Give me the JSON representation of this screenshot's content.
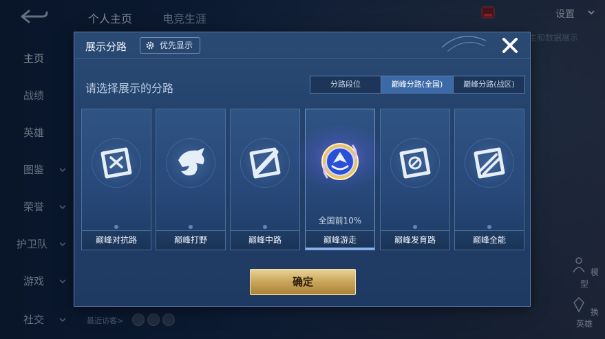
{
  "topbar": {
    "tabs": [
      "个人主页",
      "电竞生涯"
    ],
    "settings_label": "设置",
    "behind_text": "主和数据展示"
  },
  "leftnav": {
    "items": [
      "主页",
      "战绩",
      "英雄",
      "图鉴",
      "荣誉",
      "护卫队",
      "游戏",
      "社交"
    ]
  },
  "side_buttons": [
    "模型",
    "换英雄"
  ],
  "bottom": {
    "recent_label": "最近访客>"
  },
  "modal": {
    "title": "展示分路",
    "priority_label": "优先显示",
    "subtitle": "请选择展示的分路",
    "segments": [
      "分路段位",
      "巅峰分路(全国)",
      "巅峰分路(战区)"
    ],
    "selected_segment": "巅峰分路(全国)",
    "cards": [
      {
        "name": "巅峰对抗路",
        "icon": "clash-lane-icon",
        "rank": ""
      },
      {
        "name": "巅峰打野",
        "icon": "jungle-icon",
        "rank": ""
      },
      {
        "name": "巅峰中路",
        "icon": "mid-lane-icon",
        "rank": ""
      },
      {
        "name": "巅峰游走",
        "icon": "roam-icon",
        "rank": "全国前10%"
      },
      {
        "name": "巅峰发育路",
        "icon": "farm-lane-icon",
        "rank": ""
      },
      {
        "name": "巅峰全能",
        "icon": "all-round-icon",
        "rank": ""
      }
    ],
    "confirm_label": "确定"
  },
  "colors": {
    "accent": "#3c6aa8",
    "confirm_gold": "#c9a55b",
    "selected_glow": "#8278ff"
  }
}
